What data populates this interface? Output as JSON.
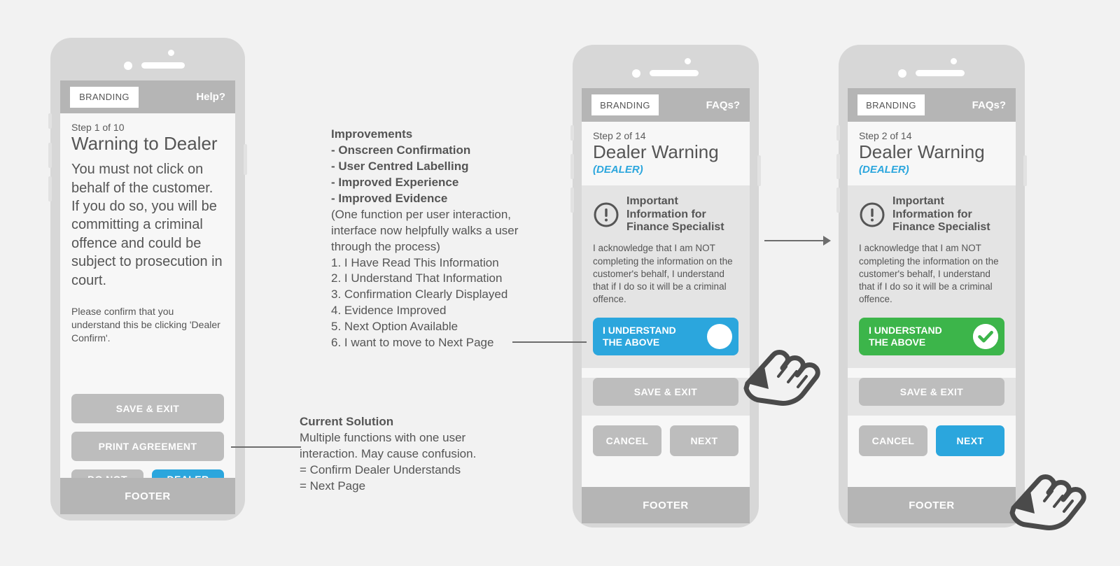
{
  "colors": {
    "accent_blue": "#2ba6dd",
    "confirm_green": "#3cb54a",
    "chrome_grey": "#b5b5b5",
    "button_grey": "#bdbdbd",
    "canvas": "#f2f2f2"
  },
  "phone1": {
    "appbar": {
      "branding": "BRANDING",
      "link": "Help?"
    },
    "step": "Step 1 of 10",
    "title": "Warning to Dealer",
    "body": "You must not click on behalf of the customer. If you do so, you will be committing a criminal offence and could be subject to prosecution in court.",
    "hint": "Please confirm that you understand this be clicking 'Dealer Confirm'.",
    "buttons": {
      "save_exit": "SAVE & EXIT",
      "print_agreement": "PRINT AGREEMENT",
      "do_not_proceed": "DO NOT PROCEED",
      "dealer_confirm": "DEALER CONFIRM"
    },
    "footer": "FOOTER"
  },
  "phone2": {
    "appbar": {
      "branding": "BRANDING",
      "link": "FAQs?"
    },
    "step": "Step 2 of 14",
    "title": "Dealer Warning",
    "subtitle": "(DEALER)",
    "info_heading": "Important Information for Finance Specialist",
    "acknowledgement": "I acknowledge that I am NOT completing the information on the customer's behalf, I understand that if I do so it will be a criminal offence.",
    "toggle_label": "I UNDERSTAND THE ABOVE",
    "toggle_state": "off",
    "buttons": {
      "save_exit": "SAVE & EXIT",
      "cancel": "CANCEL",
      "next": "NEXT"
    },
    "footer": "FOOTER"
  },
  "phone3": {
    "appbar": {
      "branding": "BRANDING",
      "link": "FAQs?"
    },
    "step": "Step 2 of 14",
    "title": "Dealer Warning",
    "subtitle": "(DEALER)",
    "info_heading": "Important Information for Finance Specialist",
    "acknowledgement": "I acknowledge that I am NOT completing the information on the customer's behalf, I understand that if I do so it will be a criminal offence.",
    "toggle_label": "I UNDERSTAND THE ABOVE",
    "toggle_state": "on",
    "buttons": {
      "save_exit": "SAVE & EXIT",
      "cancel": "CANCEL",
      "next": "NEXT"
    },
    "footer": "FOOTER"
  },
  "improvements": {
    "heading": "Improvements",
    "bullets": [
      "- Onscreen Confirmation",
      "- User Centred Labelling",
      "- Improved Experience",
      "- Improved Evidence"
    ],
    "note": "(One function per user interaction, interface now helpfully walks a user through the process)",
    "steps": [
      "1. I Have Read This Information",
      "2. I Understand That Information",
      "3. Confirmation Clearly Displayed",
      "4. Evidence Improved",
      "5. Next Option Available",
      "6. I want to move to Next Page"
    ]
  },
  "current_solution": {
    "heading": "Current Solution",
    "lines": [
      "Multiple functions with one user",
      "interaction. May cause confusion.",
      "= Confirm Dealer Understands",
      "= Next Page"
    ]
  }
}
